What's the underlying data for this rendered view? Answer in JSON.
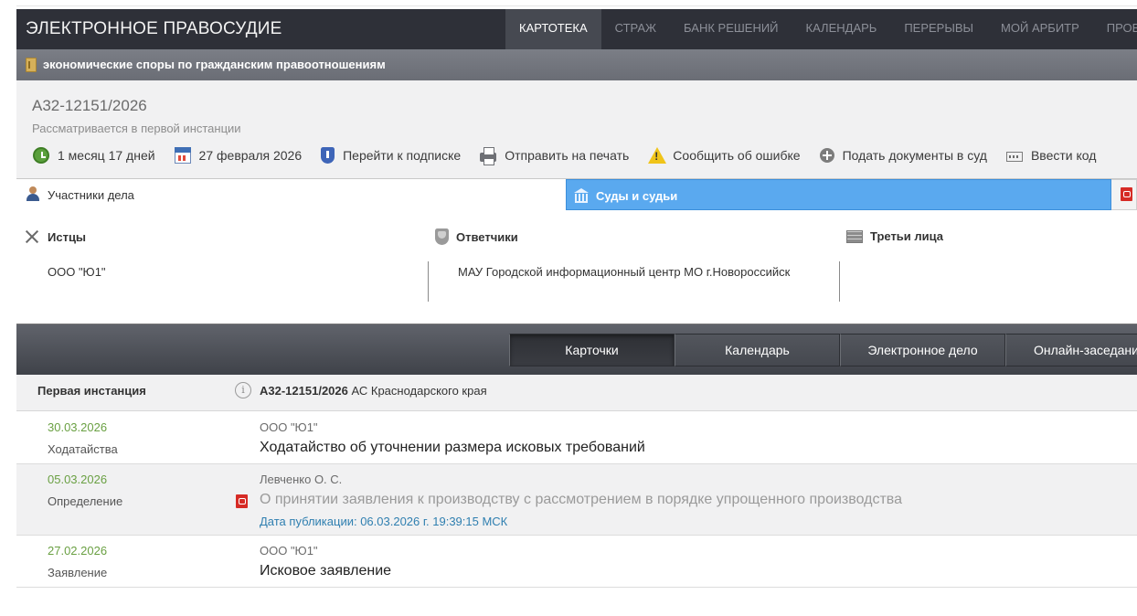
{
  "header": {
    "brand": "ЭЛЕКТРОННОЕ ПРАВОСУДИЕ",
    "nav": [
      "КАРТОТЕКА",
      "СТРАЖ",
      "БАНК РЕШЕНИЙ",
      "КАЛЕНДАРЬ",
      "ПЕРЕРЫВЫ",
      "МОЙ АРБИТР",
      "ПРОВЕР"
    ],
    "active_nav": "КАРТОТЕКА"
  },
  "category": {
    "icon": "folder-icon",
    "label": "экономические споры по гражданским правоотношениям"
  },
  "case": {
    "number": "А32-12151/2026",
    "status": "Рассматривается в первой инстанции",
    "actions": [
      {
        "icon": "clock-icon",
        "label": "1 месяц 17 дней"
      },
      {
        "icon": "calendar-icon",
        "label": "27 февраля 2026"
      },
      {
        "icon": "shield-icon",
        "label": "Перейти к подписке"
      },
      {
        "icon": "printer-icon",
        "label": "Отправить на печать"
      },
      {
        "icon": "warning-icon",
        "label": "Сообщить об ошибке"
      },
      {
        "icon": "plus-circle-icon",
        "label": "Подать документы в суд"
      },
      {
        "icon": "code-icon",
        "label": "Ввести код"
      }
    ]
  },
  "sections": {
    "participants": "Участники дела",
    "courts": "Суды и судьи"
  },
  "participants": {
    "plaintiffs": {
      "title": "Истцы",
      "value": "ООО \"Ю1\""
    },
    "defendants": {
      "title": "Ответчики",
      "value": "МАУ Городской информационный центр МО г.Новороссийск"
    },
    "third_parties": {
      "title": "Третьи лица",
      "value": ""
    }
  },
  "tabs": [
    "Карточки",
    "Календарь",
    "Электронное дело",
    "Онлайн-заседания"
  ],
  "active_tab": "Карточки",
  "instance": {
    "title": "Первая инстанция",
    "case_number": "А32-12151/2026",
    "court": "АС Краснодарского края"
  },
  "documents": [
    {
      "date": "30.03.2026",
      "type": "Ходатайства",
      "author": "ООО \"Ю1\"",
      "title": "Ходатайство об уточнении размера исковых требований",
      "publication": ""
    },
    {
      "date": "05.03.2026",
      "type": "Определение",
      "author": "Левченко О. С.",
      "title": "О принятии заявления к производству с рассмотрением в порядке упрощенного производства",
      "publication": "Дата публикации: 06.03.2026 г. 19:39:15 МСК"
    },
    {
      "date": "27.02.2026",
      "type": "Заявление",
      "author": "ООО \"Ю1\"",
      "title": "Исковое заявление",
      "publication": ""
    }
  ],
  "colors": {
    "header_bg": "#2e3038",
    "accent_blue": "#5aa9ef",
    "date_green": "#6aa043",
    "link_blue": "#2f7fb0"
  }
}
